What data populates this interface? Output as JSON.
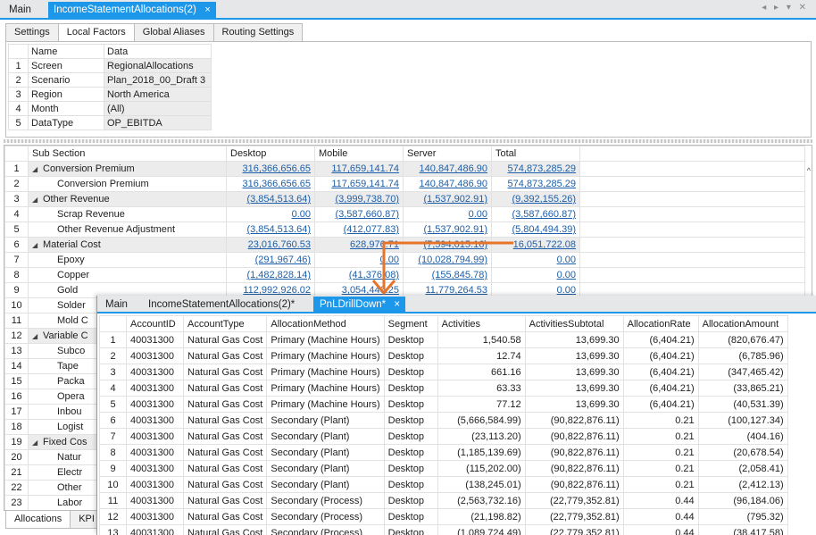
{
  "doc_tabs": {
    "main": "Main",
    "active": "IncomeStatementAllocations(2)",
    "close": "×",
    "controls": "◂ ▸ ▾ ✕"
  },
  "sub_tabs": [
    "Settings",
    "Local Factors",
    "Global Aliases",
    "Routing Settings"
  ],
  "local_factors": {
    "headers": [
      "Name",
      "Data"
    ],
    "rows": [
      {
        "n": "1",
        "name": "Screen",
        "data": "RegionalAllocations"
      },
      {
        "n": "2",
        "name": "Scenario",
        "data": "Plan_2018_00_Draft 3"
      },
      {
        "n": "3",
        "name": "Region",
        "data": "North America"
      },
      {
        "n": "4",
        "name": "Month",
        "data": "(All)"
      },
      {
        "n": "5",
        "name": "DataType",
        "data": "OP_EBITDA"
      }
    ]
  },
  "pnl": {
    "headers": [
      "Sub Section",
      "Desktop",
      "Mobile",
      "Server",
      "Total"
    ],
    "rows": [
      {
        "n": "1",
        "grp": true,
        "label": "Conversion Premium",
        "d": "316,366,656.65",
        "m": "117,659,141.74",
        "s": "140,847,486.90",
        "t": "574,873,285.29"
      },
      {
        "n": "2",
        "grp": false,
        "label": "Conversion Premium",
        "d": "316,366,656.65",
        "m": "117,659,141.74",
        "s": "140,847,486.90",
        "t": "574,873,285.29"
      },
      {
        "n": "3",
        "grp": true,
        "label": "Other Revenue",
        "d": "(3,854,513.64)",
        "m": "(3,999,738.70)",
        "s": "(1,537,902.91)",
        "t": "(9,392,155.26)"
      },
      {
        "n": "4",
        "grp": false,
        "label": "Scrap Revenue",
        "d": "0.00",
        "m": "(3,587,660.87)",
        "s": "0.00",
        "t": "(3,587,660.87)"
      },
      {
        "n": "5",
        "grp": false,
        "label": "Other Revenue Adjustment",
        "d": "(3,854,513.64)",
        "m": "(412,077.83)",
        "s": "(1,537,902.91)",
        "t": "(5,804,494.39)"
      },
      {
        "n": "6",
        "grp": true,
        "label": "Material Cost",
        "d": "23,016,760.53",
        "m": "628,976.71",
        "s": "(7,594,015.16)",
        "t": "16,051,722.08"
      },
      {
        "n": "7",
        "grp": false,
        "label": "Epoxy",
        "d": "(291,967.46)",
        "m": "0.00",
        "s": "(10,028,794.99)",
        "t": "0.00"
      },
      {
        "n": "8",
        "grp": false,
        "label": "Copper",
        "d": "(1,482,828.14)",
        "m": "(41,376.08)",
        "s": "(155,845.78)",
        "t": "0.00"
      },
      {
        "n": "9",
        "grp": false,
        "label": "Gold",
        "d": "112,992,926.02",
        "m": "3,054,440.25",
        "s": "11,779,264.53",
        "t": "0.00"
      },
      {
        "n": "10",
        "grp": false,
        "label": "Solder",
        "d": "",
        "m": "",
        "s": "",
        "t": ""
      },
      {
        "n": "11",
        "grp": false,
        "label": "Mold C",
        "d": "",
        "m": "",
        "s": "",
        "t": ""
      },
      {
        "n": "12",
        "grp": true,
        "label": "Variable C",
        "d": "",
        "m": "",
        "s": "",
        "t": ""
      },
      {
        "n": "13",
        "grp": false,
        "label": "Subco",
        "d": "",
        "m": "",
        "s": "",
        "t": ""
      },
      {
        "n": "14",
        "grp": false,
        "label": "Tape",
        "d": "",
        "m": "",
        "s": "",
        "t": ""
      },
      {
        "n": "15",
        "grp": false,
        "label": "Packa",
        "d": "",
        "m": "",
        "s": "",
        "t": ""
      },
      {
        "n": "16",
        "grp": false,
        "label": "Opera",
        "d": "",
        "m": "",
        "s": "",
        "t": ""
      },
      {
        "n": "17",
        "grp": false,
        "label": "Inbou",
        "d": "",
        "m": "",
        "s": "",
        "t": ""
      },
      {
        "n": "18",
        "grp": false,
        "label": "Logist",
        "d": "",
        "m": "",
        "s": "",
        "t": ""
      },
      {
        "n": "19",
        "grp": true,
        "label": "Fixed Cos",
        "d": "",
        "m": "",
        "s": "",
        "t": ""
      },
      {
        "n": "20",
        "grp": false,
        "label": "Natur",
        "d": "",
        "m": "",
        "s": "",
        "t": ""
      },
      {
        "n": "21",
        "grp": false,
        "label": "Electr",
        "d": "",
        "m": "",
        "s": "",
        "t": ""
      },
      {
        "n": "22",
        "grp": false,
        "label": "Other",
        "d": "",
        "m": "",
        "s": "",
        "t": ""
      },
      {
        "n": "23",
        "grp": false,
        "label": "Labor",
        "d": "",
        "m": "",
        "s": "",
        "t": ""
      }
    ]
  },
  "bottom_tabs": [
    "Allocations",
    "KPI"
  ],
  "drill": {
    "tabs": {
      "main": "Main",
      "alloc": "IncomeStatementAllocations(2)*",
      "active": "PnLDrillDown*",
      "close": "×"
    },
    "headers": [
      "AccountID",
      "AccountType",
      "AllocationMethod",
      "Segment",
      "Activities",
      "ActivitiesSubtotal",
      "AllocationRate",
      "AllocationAmount"
    ],
    "rows": [
      [
        "1",
        "40031300",
        "Natural Gas Cost",
        "Primary (Machine Hours)",
        "Desktop",
        "1,540.58",
        "13,699.30",
        "(6,404.21)",
        "(820,676.47)"
      ],
      [
        "2",
        "40031300",
        "Natural Gas Cost",
        "Primary (Machine Hours)",
        "Desktop",
        "12.74",
        "13,699.30",
        "(6,404.21)",
        "(6,785.96)"
      ],
      [
        "3",
        "40031300",
        "Natural Gas Cost",
        "Primary (Machine Hours)",
        "Desktop",
        "661.16",
        "13,699.30",
        "(6,404.21)",
        "(347,465.42)"
      ],
      [
        "4",
        "40031300",
        "Natural Gas Cost",
        "Primary (Machine Hours)",
        "Desktop",
        "63.33",
        "13,699.30",
        "(6,404.21)",
        "(33,865.21)"
      ],
      [
        "5",
        "40031300",
        "Natural Gas Cost",
        "Primary (Machine Hours)",
        "Desktop",
        "77.12",
        "13,699.30",
        "(6,404.21)",
        "(40,531.39)"
      ],
      [
        "6",
        "40031300",
        "Natural Gas Cost",
        "Secondary (Plant)",
        "Desktop",
        "(5,666,584.99)",
        "(90,822,876.11)",
        "0.21",
        "(100,127.34)"
      ],
      [
        "7",
        "40031300",
        "Natural Gas Cost",
        "Secondary (Plant)",
        "Desktop",
        "(23,113.20)",
        "(90,822,876.11)",
        "0.21",
        "(404.16)"
      ],
      [
        "8",
        "40031300",
        "Natural Gas Cost",
        "Secondary (Plant)",
        "Desktop",
        "(1,185,139.69)",
        "(90,822,876.11)",
        "0.21",
        "(20,678.54)"
      ],
      [
        "9",
        "40031300",
        "Natural Gas Cost",
        "Secondary (Plant)",
        "Desktop",
        "(115,202.00)",
        "(90,822,876.11)",
        "0.21",
        "(2,058.41)"
      ],
      [
        "10",
        "40031300",
        "Natural Gas Cost",
        "Secondary (Plant)",
        "Desktop",
        "(138,245.01)",
        "(90,822,876.11)",
        "0.21",
        "(2,412.13)"
      ],
      [
        "11",
        "40031300",
        "Natural Gas Cost",
        "Secondary (Process)",
        "Desktop",
        "(2,563,732.16)",
        "(22,779,352.81)",
        "0.44",
        "(96,184.06)"
      ],
      [
        "12",
        "40031300",
        "Natural Gas Cost",
        "Secondary (Process)",
        "Desktop",
        "(21,198.82)",
        "(22,779,352.81)",
        "0.44",
        "(795.32)"
      ],
      [
        "13",
        "40031300",
        "Natural Gas Cost",
        "Secondary (Process)",
        "Desktop",
        "(1,089,724.49)",
        "(22,779,352.81)",
        "0.44",
        "(38,417.58)"
      ]
    ]
  },
  "colors": {
    "accent": "#1c97ea",
    "link": "#1d5fa8",
    "arrow": "#e8742a",
    "group_bg": "#ececec"
  }
}
